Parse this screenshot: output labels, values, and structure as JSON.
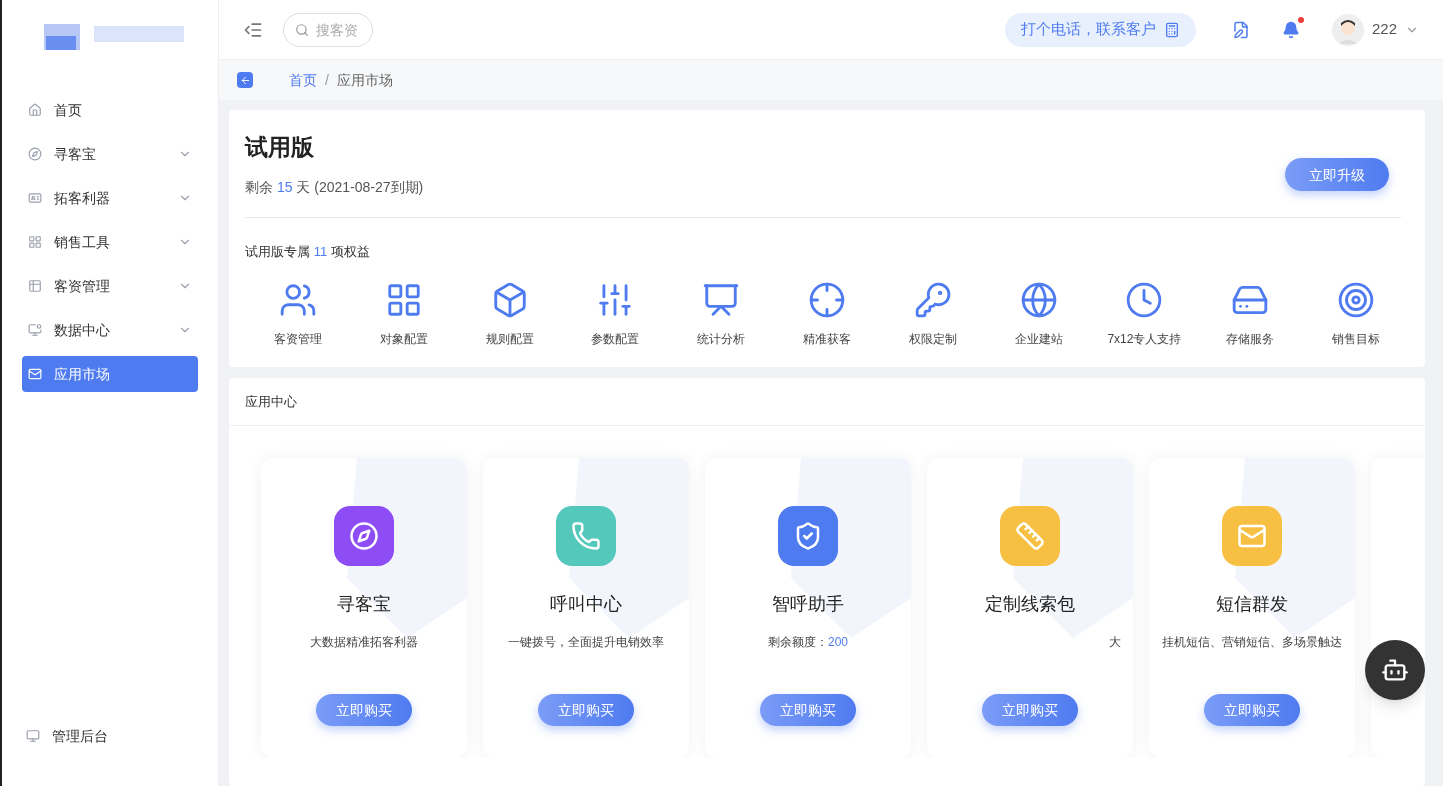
{
  "header": {
    "search": {
      "placeholder": "搜客资"
    },
    "call_button": "打个电话，联系客户",
    "notifications": {
      "unread": true
    },
    "user": {
      "name": "222"
    }
  },
  "sidebar": {
    "items": [
      {
        "label": "首页",
        "selected": false,
        "expandable": false
      },
      {
        "label": "寻客宝",
        "selected": false,
        "expandable": true
      },
      {
        "label": "拓客利器",
        "selected": false,
        "expandable": true
      },
      {
        "label": "销售工具",
        "selected": false,
        "expandable": true
      },
      {
        "label": "客资管理",
        "selected": false,
        "expandable": true
      },
      {
        "label": "数据中心",
        "selected": false,
        "expandable": true
      },
      {
        "label": "应用市场",
        "selected": true,
        "expandable": false
      }
    ],
    "footer": "管理后台"
  },
  "breadcrumb": {
    "separator": "/",
    "items": [
      {
        "label": "首页",
        "link": true
      },
      {
        "label": "应用市场",
        "link": false
      }
    ]
  },
  "trial": {
    "title": "试用版",
    "remaining": "剩余 **15** 天 (2021-08-27到期)",
    "upgrade_button": "立即升级",
    "benefits_title": "试用版专属 **11** 项权益",
    "benefits": [
      "客资管理",
      "对象配置",
      "规则配置",
      "参数配置",
      "统计分析",
      "精准获客",
      "权限定制",
      "企业建站",
      "7x12专人支持",
      "存储服务",
      "销售目标"
    ]
  },
  "app_center": {
    "title": "应用中心",
    "cards": [
      {
        "name": "寻客宝",
        "description": "大数据精准拓客利器",
        "color": "#8e4cf5",
        "button": "立即购买"
      },
      {
        "name": "呼叫中心",
        "description": "一键拨号，全面提升电销效率",
        "color": "#55c8bc",
        "button": "立即购买"
      },
      {
        "name": "智呼助手",
        "description": "剩余额度：**200**",
        "color": "#4f7bf0",
        "button": "立即购买"
      },
      {
        "name": "定制线索包",
        "description": "大",
        "color": "#f7c043",
        "button": "立即购买"
      },
      {
        "name": "短信群发",
        "description": "挂机短信、营销短信、多场景触达",
        "color": "#f7c043",
        "button": "立即购买"
      }
    ]
  }
}
